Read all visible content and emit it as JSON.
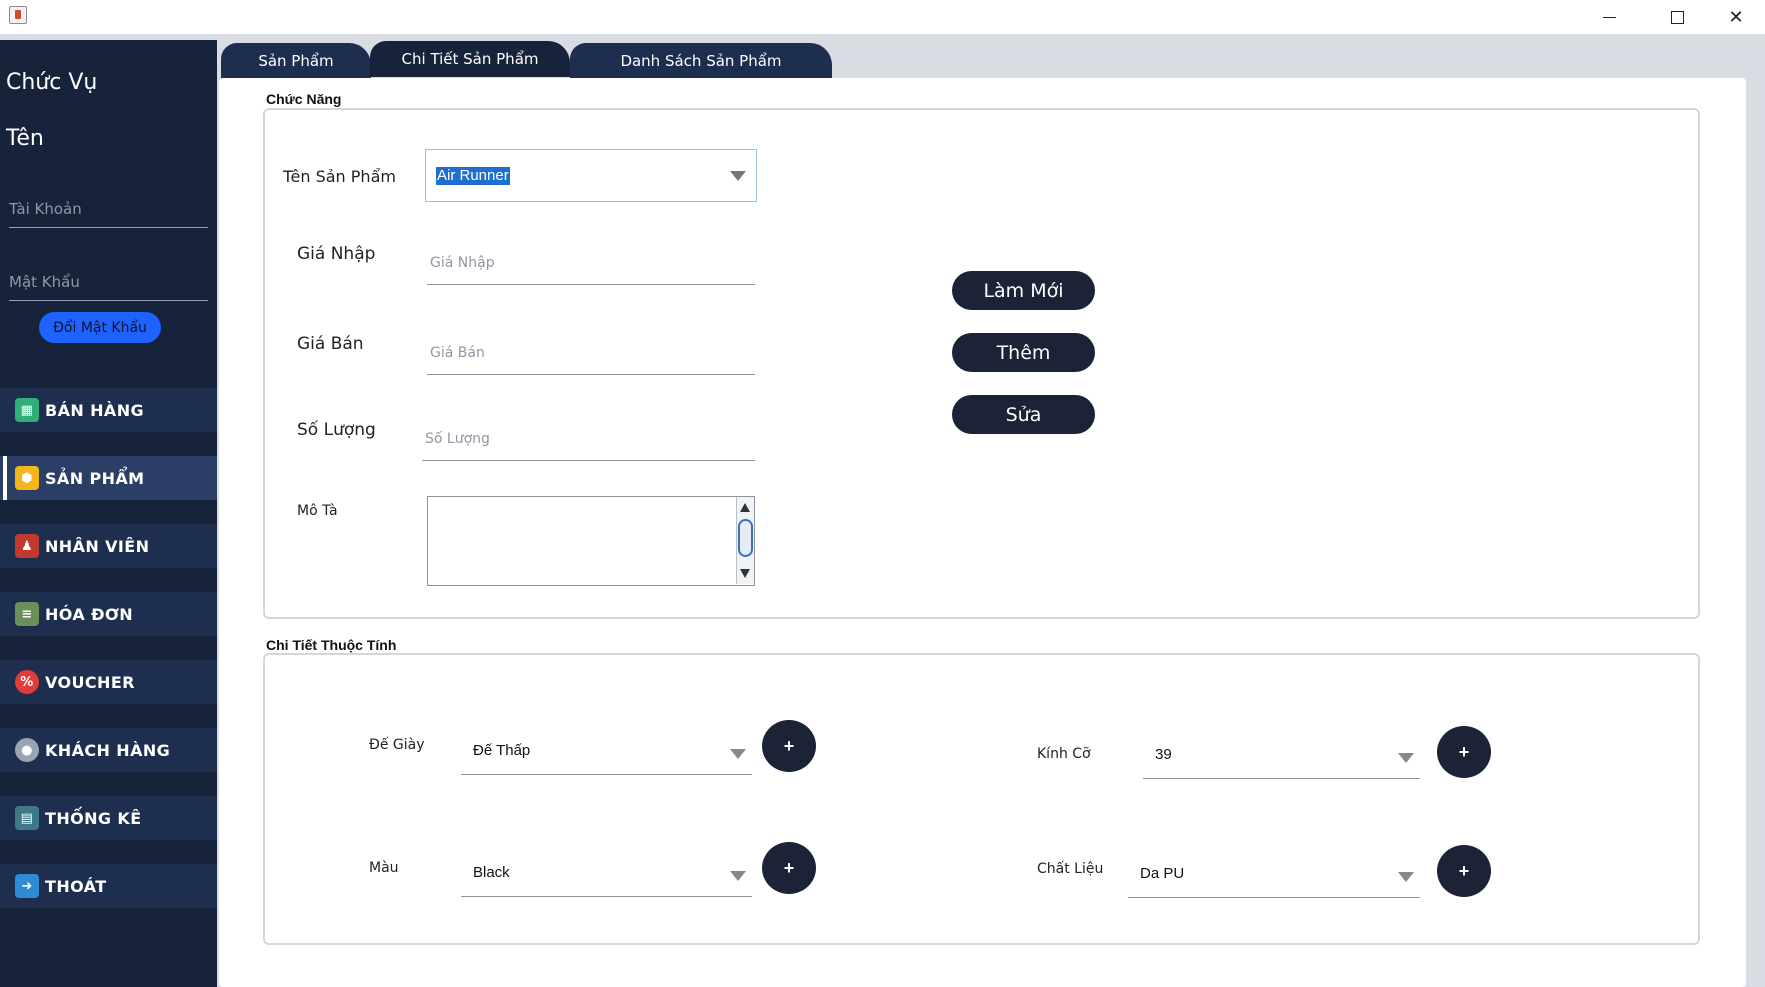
{
  "window": {
    "controls": {
      "minimize": "minimize",
      "maximize": "maximize",
      "close": "✕"
    }
  },
  "sidebar": {
    "role_label": "Chức Vụ",
    "name_label": "Tên",
    "account_placeholder": "Tài Khoản",
    "password_placeholder": "Mật Khẩu",
    "change_password_button": "Đổi Mật Khẩu",
    "menu": [
      {
        "label": "BÁN HÀNG",
        "icon": "store-icon",
        "icon_color": "#2fae7a"
      },
      {
        "label": "SẢN PHẨM",
        "icon": "box-icon",
        "icon_color": "#f2b51c",
        "active": true
      },
      {
        "label": "NHÂN VIÊN",
        "icon": "employee-icon",
        "icon_color": "#c0392b"
      },
      {
        "label": "HÓA ĐƠN",
        "icon": "invoice-icon",
        "icon_color": "#6b8f5a"
      },
      {
        "label": "VOUCHER",
        "icon": "voucher-icon",
        "icon_color": "#e23b3b"
      },
      {
        "label": "KHÁCH HÀNG",
        "icon": "customer-icon",
        "icon_color": "#9aa4b5"
      },
      {
        "label": "THỐNG KÊ",
        "icon": "statistics-icon",
        "icon_color": "#3c7a8a"
      },
      {
        "label": "THOÁT",
        "icon": "exit-icon",
        "icon_color": "#2f8bd6"
      }
    ]
  },
  "tabs": [
    {
      "label": "Sản Phẩm"
    },
    {
      "label": "Chi Tiết Sản Phẩm",
      "active": true
    },
    {
      "label": "Danh Sách Sản Phẩm"
    }
  ],
  "function_section": {
    "title": "Chức Năng",
    "product_name_label": "Tên Sản Phẩm",
    "product_name_value": "Air Runner",
    "import_price_label": "Giá Nhập",
    "import_price_placeholder": "Giá Nhập",
    "sale_price_label": "Giá Bán",
    "sale_price_placeholder": "Giá Bán",
    "quantity_label": "Số Lượng",
    "quantity_placeholder": "Số Lượng",
    "description_label": "Mô Tà",
    "buttons": {
      "refresh": "Làm Mới",
      "add": "Thêm",
      "edit": "Sửa"
    }
  },
  "attributes_section": {
    "title": "Chi Tiết Thuộc Tính",
    "sole_label": "Đế Giày",
    "sole_value": "Đế Thấp",
    "size_label": "Kính Cỡ",
    "size_value": "39",
    "color_label": "Màu",
    "color_value": "Black",
    "material_label": "Chất Liệu",
    "material_value": "Da PU",
    "add_symbol": "+"
  },
  "colors": {
    "sidebar_bg": "#17233a",
    "menu_bg": "#1d2e4e",
    "accent_blue": "#1e62ff",
    "button_dark": "#1c2336"
  }
}
